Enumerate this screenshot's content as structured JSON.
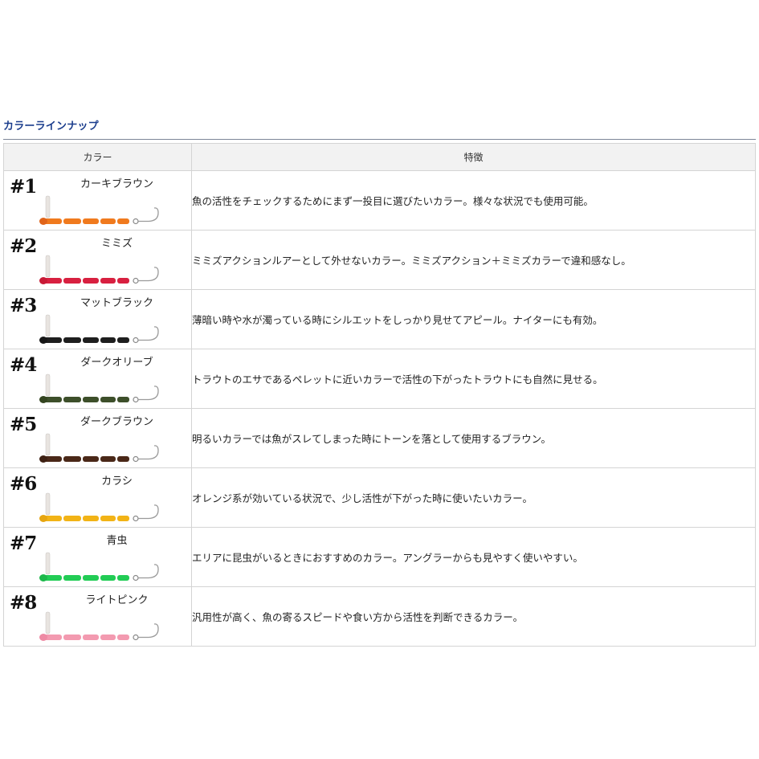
{
  "section_title": "カラーラインナップ",
  "table": {
    "headers": {
      "color": "カラー",
      "features": "特徴"
    },
    "rows": [
      {
        "number": "#1",
        "name": "カーキブラウン",
        "feature": "魚の活性をチェックするためにまず一投目に選びたいカラー。様々な状況でも使用可能。",
        "body_color": "#f07a1e",
        "head_color": "#e0641a"
      },
      {
        "number": "#2",
        "name": "ミミズ",
        "feature": "ミミズアクションルアーとして外せないカラー。ミミズアクション＋ミミズカラーで違和感なし。",
        "body_color": "#d82040",
        "head_color": "#c81a36"
      },
      {
        "number": "#3",
        "name": "マットブラック",
        "feature": "薄暗い時や水が濁っている時にシルエットをしっかり見せてアピール。ナイターにも有効。",
        "body_color": "#1e1e1e",
        "head_color": "#161616"
      },
      {
        "number": "#4",
        "name": "ダークオリーブ",
        "feature": "トラウトのエサであるペレットに近いカラーで活性の下がったトラウトにも自然に見せる。",
        "body_color": "#3d4f2a",
        "head_color": "#33441f"
      },
      {
        "number": "#5",
        "name": "ダークブラウン",
        "feature": "明るいカラーでは魚がスレてしまった時にトーンを落として使用するブラウン。",
        "body_color": "#4a2818",
        "head_color": "#3d2012"
      },
      {
        "number": "#6",
        "name": "カラシ",
        "feature": "オレンジ系が効いている状況で、少し活性が下がった時に使いたいカラー。",
        "body_color": "#f2b316",
        "head_color": "#e6a510"
      },
      {
        "number": "#7",
        "name": "青虫",
        "feature": "エリアに昆虫がいるときにおすすめのカラー。アングラーからも見やすく使いやすい。",
        "body_color": "#22cc55",
        "head_color": "#1cb84a"
      },
      {
        "number": "#8",
        "name": "ライトピンク",
        "feature": "汎用性が高く、魚の寄るスピードや食い方から活性を判断できるカラー。",
        "body_color": "#f39ab0",
        "head_color": "#ee8aa4"
      }
    ]
  }
}
